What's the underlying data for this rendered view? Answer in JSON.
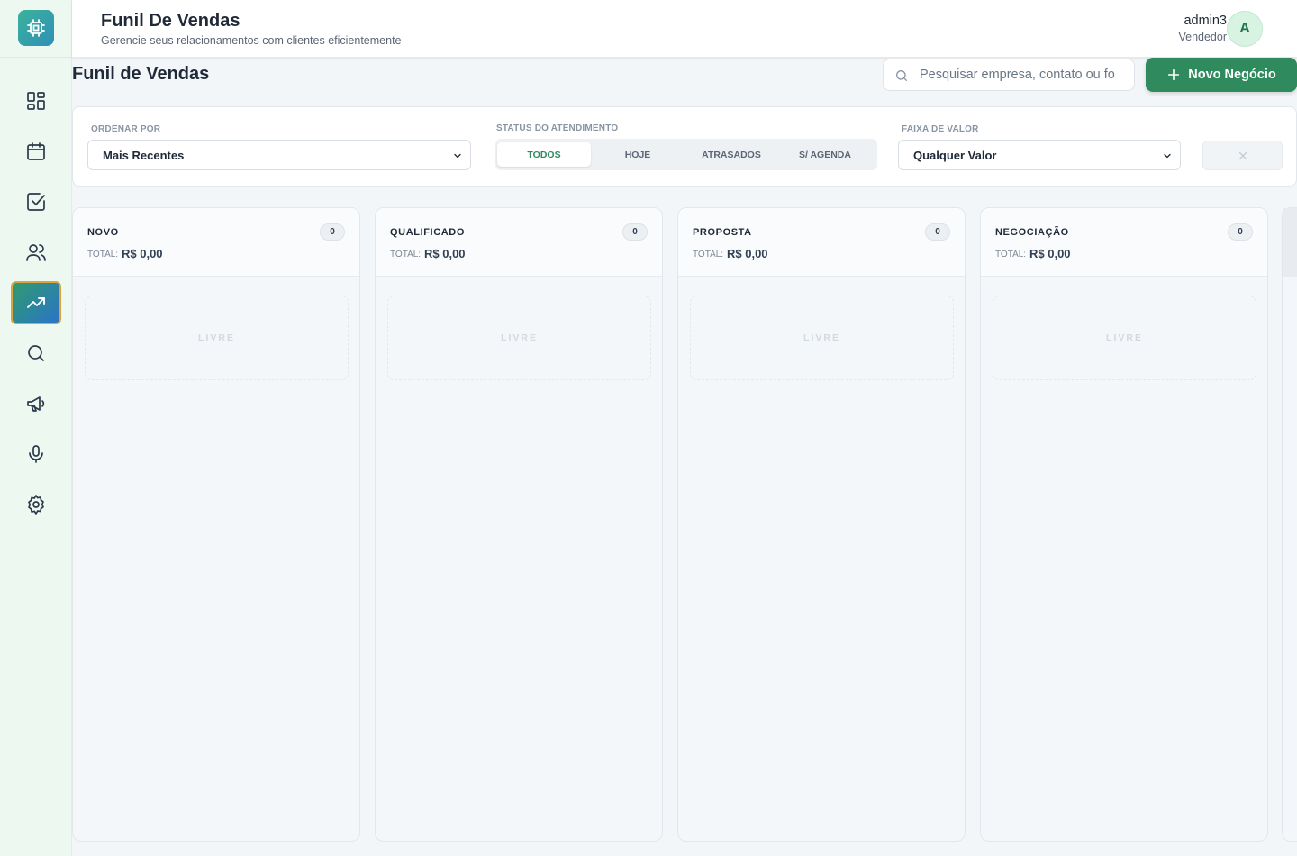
{
  "header": {
    "title": "Funil De Vendas",
    "subtitle": "Gerencie seus relacionamentos com clientes eficientemente",
    "user_name": "admin3",
    "user_role": "Vendedor",
    "avatar_initial": "A"
  },
  "sidebar": {
    "items": [
      {
        "icon": "dashboard-icon"
      },
      {
        "icon": "calendar-icon"
      },
      {
        "icon": "task-check-icon"
      },
      {
        "icon": "users-icon"
      },
      {
        "icon": "trending-up-icon",
        "active": true
      },
      {
        "icon": "search-icon"
      },
      {
        "icon": "megaphone-icon"
      },
      {
        "icon": "microphone-icon"
      },
      {
        "icon": "settings-icon"
      }
    ]
  },
  "page": {
    "title": "Funil de Vendas",
    "search_placeholder": "Pesquisar empresa, contato ou fo",
    "new_button_label": "Novo Negócio"
  },
  "filters": {
    "sort_label": "ORDENAR POR",
    "sort_value": "Mais Recentes",
    "status_label": "STATUS DO ATENDIMENTO",
    "status_options": [
      "TODOS",
      "HOJE",
      "ATRASADOS",
      "S/ AGENDA"
    ],
    "status_selected": "TODOS",
    "value_label": "FAIXA DE VALOR",
    "value_value": "Qualquer Valor"
  },
  "columns": [
    {
      "name": "NOVO",
      "count": "0",
      "total_label": "TOTAL:",
      "total": "R$ 0,00",
      "empty": "LIVRE"
    },
    {
      "name": "QUALIFICADO",
      "count": "0",
      "total_label": "TOTAL:",
      "total": "R$ 0,00",
      "empty": "LIVRE"
    },
    {
      "name": "PROPOSTA",
      "count": "0",
      "total_label": "TOTAL:",
      "total": "R$ 0,00",
      "empty": "LIVRE"
    },
    {
      "name": "NEGOCIAÇÃO",
      "count": "0",
      "total_label": "TOTAL:",
      "total": "R$ 0,00",
      "empty": "LIVRE"
    }
  ],
  "colors": {
    "accent": "#2f8a5e",
    "sidebar_bg": "#edf8f1"
  }
}
